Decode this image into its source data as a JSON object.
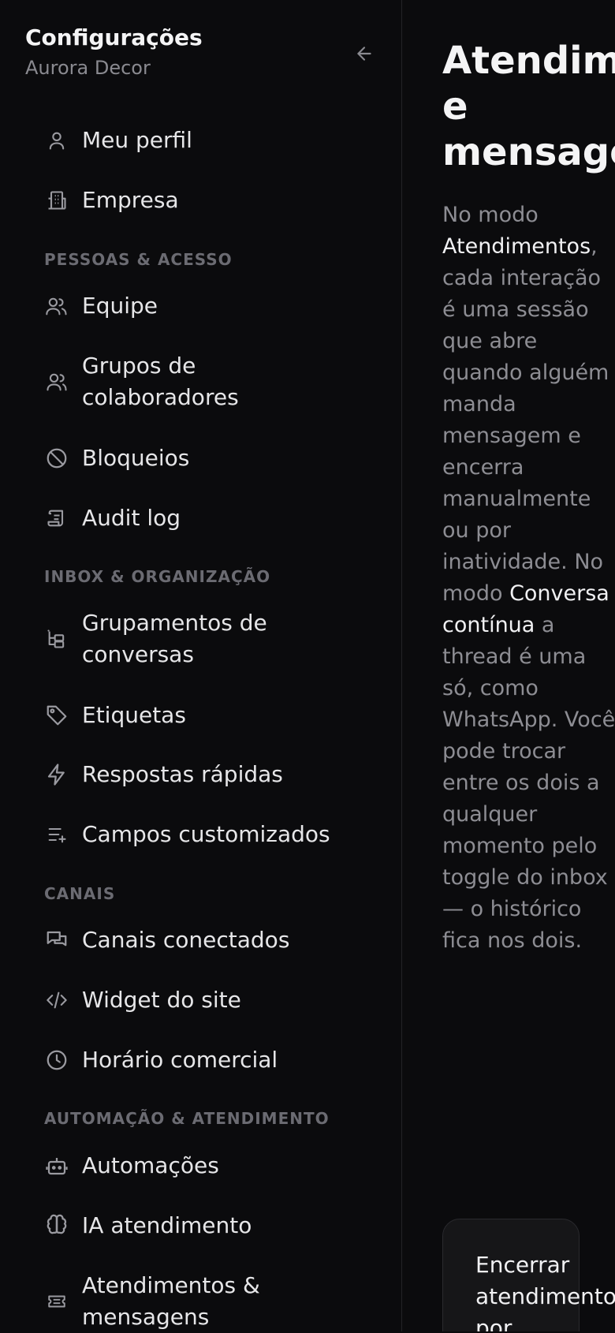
{
  "sidebar": {
    "title": "Configurações",
    "subtitle": "Aurora Decor",
    "top_items": [
      {
        "label": "Meu perfil",
        "icon": "user-icon"
      },
      {
        "label": "Empresa",
        "icon": "building-icon"
      }
    ],
    "sections": [
      {
        "title": "PESSOAS & ACESSO",
        "items": [
          {
            "label": "Equipe",
            "icon": "users-icon"
          },
          {
            "label": "Grupos de colaboradores",
            "icon": "user-group-icon"
          },
          {
            "label": "Bloqueios",
            "icon": "ban-icon"
          },
          {
            "label": "Audit log",
            "icon": "scroll-icon"
          }
        ]
      },
      {
        "title": "INBOX & ORGANIZAÇÃO",
        "items": [
          {
            "label": "Grupamentos de conversas",
            "icon": "tree-icon"
          },
          {
            "label": "Etiquetas",
            "icon": "tag-icon"
          },
          {
            "label": "Respostas rápidas",
            "icon": "bolt-icon"
          },
          {
            "label": "Campos customizados",
            "icon": "list-plus-icon"
          }
        ]
      },
      {
        "title": "CANAIS",
        "items": [
          {
            "label": "Canais conectados",
            "icon": "chat-bubbles-icon"
          },
          {
            "label": "Widget do site",
            "icon": "code-icon"
          },
          {
            "label": "Horário comercial",
            "icon": "clock-icon"
          }
        ]
      },
      {
        "title": "AUTOMAÇÃO & ATENDIMENTO",
        "items": [
          {
            "label": "Automações",
            "icon": "robot-icon"
          },
          {
            "label": "IA atendimento",
            "icon": "brain-icon"
          },
          {
            "label": "Atendimentos & mensagens",
            "icon": "ticket-icon"
          }
        ]
      }
    ]
  },
  "main": {
    "title": "Atendimentos e mensagens",
    "description": {
      "p1": "No modo ",
      "h1": "Atendimentos",
      "p2": ", cada interação é uma sessão que abre quando alguém manda mensagem e encerra manualmente ou por inatividade. No modo ",
      "h2": "Conversa contínua",
      "p3": " a thread é uma só, como WhatsApp. Você pode trocar entre os dois a qualquer momento pelo toggle do inbox — o histórico fica nos dois."
    },
    "card_text": "Encerrar atendimento por inatividade"
  },
  "colors": {
    "background": "#0b0b0d",
    "text": "#e8e8ea",
    "muted": "#8d8d93",
    "section": "#6b6b72"
  }
}
